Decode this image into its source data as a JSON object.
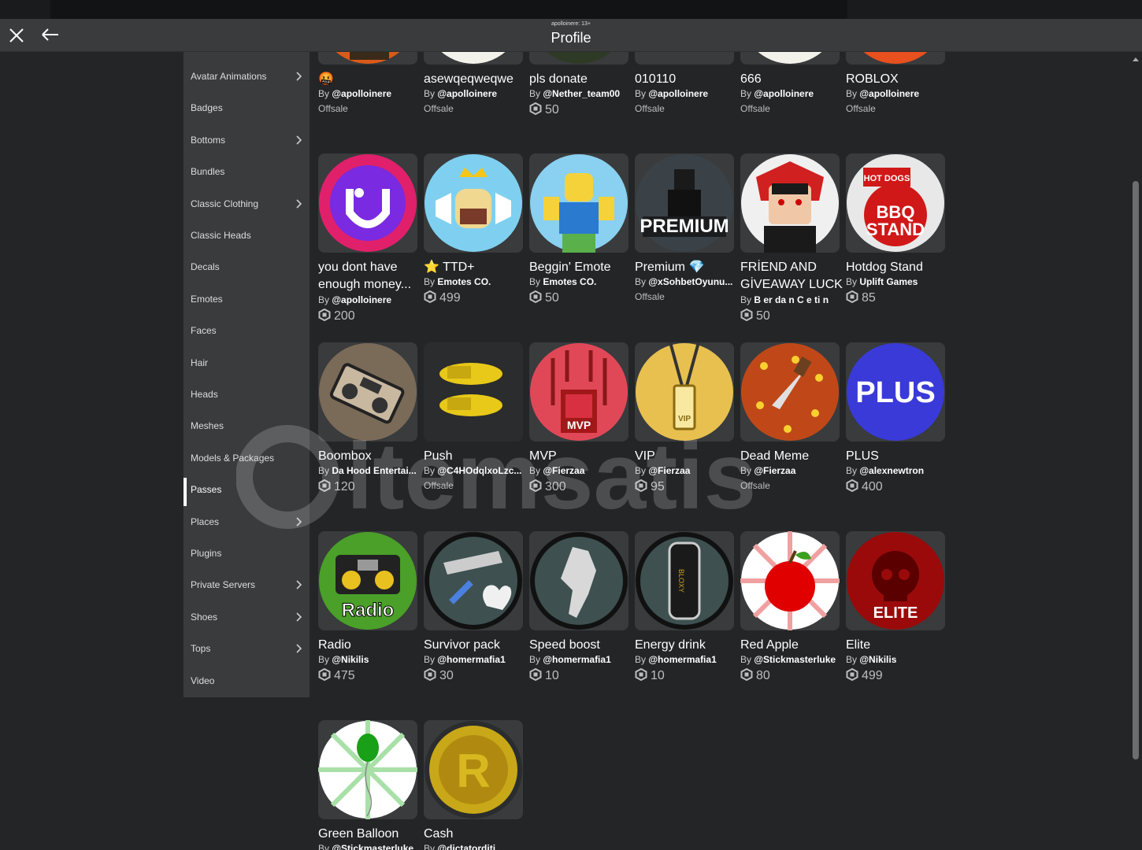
{
  "window": {
    "subtitle": "apolloinere: 13+",
    "title": "Profile"
  },
  "sidebar": {
    "items": [
      {
        "label": "Avatar Animations",
        "chevron": true
      },
      {
        "label": "Badges",
        "chevron": false
      },
      {
        "label": "Bottoms",
        "chevron": true
      },
      {
        "label": "Bundles",
        "chevron": false
      },
      {
        "label": "Classic Clothing",
        "chevron": true
      },
      {
        "label": "Classic Heads",
        "chevron": false
      },
      {
        "label": "Decals",
        "chevron": false
      },
      {
        "label": "Emotes",
        "chevron": false
      },
      {
        "label": "Faces",
        "chevron": false
      },
      {
        "label": "Hair",
        "chevron": false
      },
      {
        "label": "Heads",
        "chevron": false
      },
      {
        "label": "Meshes",
        "chevron": false
      },
      {
        "label": "Models & Packages",
        "chevron": false
      },
      {
        "label": "Passes",
        "chevron": false,
        "active": true
      },
      {
        "label": "Places",
        "chevron": true
      },
      {
        "label": "Plugins",
        "chevron": false
      },
      {
        "label": "Private Servers",
        "chevron": true
      },
      {
        "label": "Shoes",
        "chevron": true
      },
      {
        "label": "Tops",
        "chevron": true
      },
      {
        "label": "Video",
        "chevron": false
      }
    ]
  },
  "items": [
    {
      "name": "🤬",
      "by": "By",
      "creator": "@apolloinere",
      "price": "Offsale",
      "icon": "red-face-thumb"
    },
    {
      "name": "asewqeqweqwe",
      "by": "By",
      "creator": "@apolloinere",
      "price": "Offsale",
      "icon": "white-thumb"
    },
    {
      "name": "pls donate",
      "by": "By",
      "creator": "@Nether_team00",
      "price": "50",
      "icon": "dark-thumb"
    },
    {
      "name": "010110",
      "by": "By",
      "creator": "@apolloinere",
      "price": "Offsale",
      "icon": "blank-thumb"
    },
    {
      "name": "666",
      "by": "By",
      "creator": "@apolloinere",
      "price": "Offsale",
      "icon": "white-thumb"
    },
    {
      "name": "ROBLOX",
      "by": "By",
      "creator": "@apolloinere",
      "price": "Offsale",
      "icon": "orange-thumb"
    },
    {
      "name": "you dont have enough money...",
      "by": "By",
      "creator": "@apolloinere",
      "price": "200",
      "icon": "purple-smile-thumb"
    },
    {
      "name": "⭐ TTD+",
      "by": "By",
      "creator": "Emotes CO.",
      "price": "499",
      "icon": "crown-thumb"
    },
    {
      "name": "Beggin' Emote",
      "by": "By",
      "creator": "Emotes CO.",
      "price": "50",
      "icon": "noob-thumb"
    },
    {
      "name": "Premium 💎",
      "by": "By",
      "creator": "@xSohbetOyunu...",
      "price": "Offsale",
      "icon": "premium-thumb",
      "thumb_text": "PREMIUM"
    },
    {
      "name": "FRİEND AND GİVEAWAY LUCK",
      "by": "By",
      "creator": "B er da n C e ti n",
      "price": "50",
      "icon": "avatar-thumb"
    },
    {
      "name": "Hotdog Stand",
      "by": "By",
      "creator": "Uplift Games",
      "price": "85",
      "icon": "bbq-thumb",
      "thumb_text": "BBQ STAND",
      "thumb_text2": "HOT DOGS"
    },
    {
      "name": "Boombox",
      "by": "By",
      "creator": "Da Hood Entertai...",
      "price": "120",
      "icon": "boombox-thumb"
    },
    {
      "name": "Push",
      "by": "By",
      "creator": "@C4HOdqlxoLzc...",
      "price": "Offsale",
      "icon": "gold-hands-thumb"
    },
    {
      "name": "MVP",
      "by": "By",
      "creator": "@Fierzaa",
      "price": "300",
      "icon": "mvp-thumb",
      "thumb_text": "MVP"
    },
    {
      "name": "VIP",
      "by": "By",
      "creator": "@Fierzaa",
      "price": "95",
      "icon": "vip-thumb",
      "thumb_text": "VIP"
    },
    {
      "name": "Dead Meme",
      "by": "By",
      "creator": "@Fierzaa",
      "price": "Offsale",
      "icon": "knife-thumb"
    },
    {
      "name": "PLUS",
      "by": "By",
      "creator": "@alexnewtron",
      "price": "400",
      "icon": "plus-thumb",
      "thumb_text": "PLUS"
    },
    {
      "name": "Radio",
      "by": "By",
      "creator": "@Nikilis",
      "price": "475",
      "icon": "radio-thumb",
      "thumb_text": "Radio"
    },
    {
      "name": "Survivor pack",
      "by": "By",
      "creator": "@homermafia1",
      "price": "30",
      "icon": "survivor-thumb"
    },
    {
      "name": "Speed boost",
      "by": "By",
      "creator": "@homermafia1",
      "price": "10",
      "icon": "speed-thumb"
    },
    {
      "name": "Energy drink",
      "by": "By",
      "creator": "@homermafia1",
      "price": "10",
      "icon": "energy-thumb",
      "thumb_text": "BLOXY"
    },
    {
      "name": "Red Apple",
      "by": "By",
      "creator": "@Stickmasterluke",
      "price": "80",
      "icon": "apple-thumb"
    },
    {
      "name": "Elite",
      "by": "By",
      "creator": "@Nikilis",
      "price": "499",
      "icon": "elite-thumb",
      "thumb_text": "ELITE"
    },
    {
      "name": "Green Balloon",
      "by": "By",
      "creator": "@Stickmasterluke",
      "price": "",
      "icon": "balloon-thumb"
    },
    {
      "name": "Cash",
      "by": "By",
      "creator": "@dictatorditi",
      "price": "",
      "icon": "coin-thumb"
    }
  ],
  "watermark": {
    "text": "itemsatis"
  },
  "colors": {
    "background": "#232527",
    "panel": "#393b3d",
    "text": "#ffffff",
    "muted": "#bdbebe"
  }
}
